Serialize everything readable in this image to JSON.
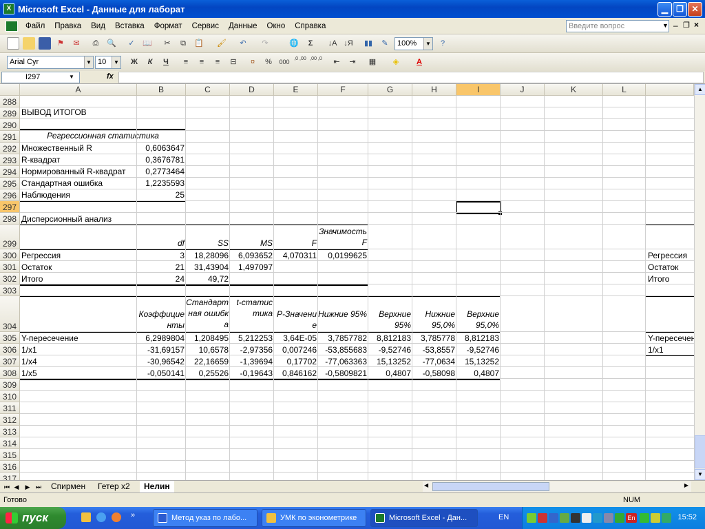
{
  "window": {
    "title": "Microsoft Excel - Данные для лаборат",
    "app_icon": "X"
  },
  "menu": {
    "items": [
      "Файл",
      "Правка",
      "Вид",
      "Вставка",
      "Формат",
      "Сервис",
      "Данные",
      "Окно",
      "Справка"
    ],
    "question_placeholder": "Введите вопрос"
  },
  "toolbar_standard": {
    "zoom": "100%"
  },
  "toolbar_format": {
    "font": "Arial Cyr",
    "size": "10",
    "bold": "Ж",
    "italic": "К",
    "underline": "Ч",
    "percent": "%",
    "thousands": "000",
    "dec_inc": ",0 ,00",
    "dec_dec": ",00 ,0"
  },
  "formula_bar": {
    "name_box": "I297",
    "fx": "fx",
    "value": ""
  },
  "columns": [
    "A",
    "B",
    "C",
    "D",
    "E",
    "F",
    "G",
    "H",
    "I",
    "J",
    "K",
    "L"
  ],
  "rows": [
    "288",
    "289",
    "290",
    "291",
    "292",
    "293",
    "294",
    "295",
    "296",
    "297",
    "298",
    "299",
    "300",
    "301",
    "302",
    "303",
    "304",
    "305",
    "306",
    "307",
    "308",
    "309",
    "310",
    "311",
    "312",
    "313",
    "314",
    "315",
    "316",
    "317"
  ],
  "cells": {
    "r289": "ВЫВОД ИТОГОВ",
    "r291": "Регрессионная статистика",
    "r292": [
      "Множественный R",
      "0,6063647"
    ],
    "r293": [
      "R-квадрат",
      "0,3676781"
    ],
    "r294": [
      "Нормированный R-квадрат",
      "0,2773464"
    ],
    "r295": [
      "Стандартная ошибка",
      "1,2235593"
    ],
    "r296": [
      "Наблюдения",
      "25"
    ],
    "r298": "Дисперсионный анализ",
    "r299": [
      "df",
      "SS",
      "MS",
      "F",
      "Значимость F"
    ],
    "r300": [
      "Регрессия",
      "3",
      "18,28096",
      "6,093652",
      "4,070311",
      "0,0199625"
    ],
    "r301": [
      "Остаток",
      "21",
      "31,43904",
      "1,497097"
    ],
    "r302": [
      "Итого",
      "24",
      "49,72"
    ],
    "r304": [
      "Коэффициенты",
      "Стандартная ошибка",
      "t-статистика",
      "P-Значение",
      "Нижние 95%",
      "Верхние 95%",
      "Нижние 95,0%",
      "Верхние 95,0%"
    ],
    "r305": [
      "Y-пересечение",
      "6,2989804",
      "1,208495",
      "5,212253",
      "3,64E-05",
      "3,7857782",
      "8,812183",
      "3,785778",
      "8,812183"
    ],
    "r306": [
      "1/x1",
      "-31,69157",
      "10,6578",
      "-2,97356",
      "0,007246",
      "-53,855683",
      "-9,52746",
      "-53,8557",
      "-9,52746"
    ],
    "r307": [
      "1/x4",
      "-30,96542",
      "22,16659",
      "-1,39694",
      "0,17702",
      "-77,063363",
      "15,13252",
      "-77,0634",
      "15,13252"
    ],
    "r308": [
      "1/x5",
      "-0,050141",
      "0,25526",
      "-0,19643",
      "0,846162",
      "-0,5809821",
      "0,4807",
      "-0,58098",
      "0,4807"
    ],
    "right_col": {
      "r300": "Регрессия",
      "r301": "Остаток",
      "r302": "Итого",
      "r305": "Y-пересечение",
      "r306": "1/x1"
    }
  },
  "sheet_tabs": [
    "Спирмен",
    "Гетер x2",
    "Нелин"
  ],
  "status": {
    "text": "Готово",
    "num": "NUM"
  },
  "taskbar": {
    "start": "пуск",
    "tasks": [
      "Метод указ по лабо...",
      "УМК по эконометрике",
      "Microsoft Excel - Дан..."
    ],
    "lang": "EN",
    "tray_lang": "En",
    "clock": "15:52"
  }
}
